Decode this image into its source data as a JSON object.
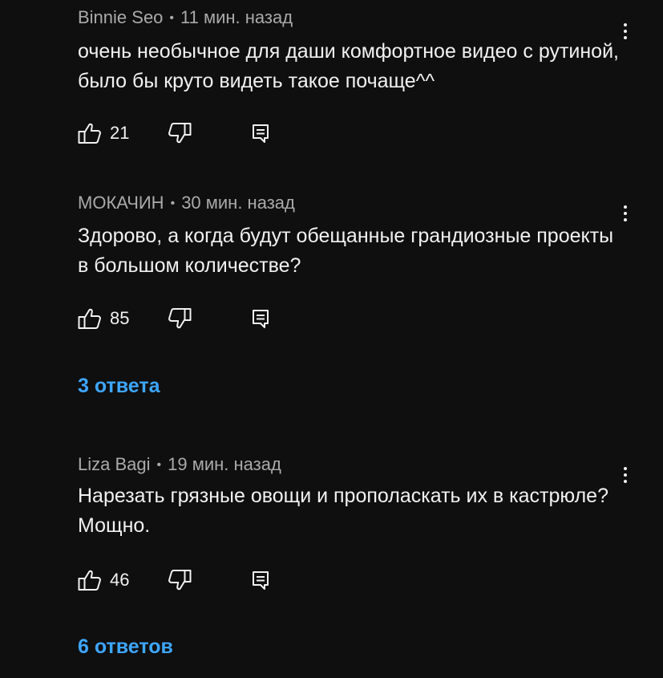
{
  "comments": [
    {
      "author": "Binnie Seo",
      "separator": "•",
      "time": "11 мин. назад",
      "text": "очень необычное для даши комфортное видео с рутиной, было бы круто видеть такое почаще^^",
      "likes": "21",
      "replies": ""
    },
    {
      "author": "МОКАЧИН",
      "separator": "•",
      "time": "30 мин. назад",
      "text": "Здорово, а когда будут обещанные грандиозные проекты в большом количестве?",
      "likes": "85",
      "replies": "3 ответа"
    },
    {
      "author": "Liza Bagi",
      "separator": "•",
      "time": "19 мин. назад",
      "text": "Нарезать грязные овощи и прополаскать их в кастрюле? Мощно.",
      "likes": "46",
      "replies": "6 ответов"
    }
  ],
  "icons": {
    "like": "thumbs-up-icon",
    "dislike": "thumbs-down-icon",
    "reply": "reply-icon",
    "menu": "more-vert-icon"
  },
  "colors": {
    "background": "#0f0f0f",
    "text": "#f1f1f1",
    "meta": "#aaaaaa",
    "link": "#3ea6ff"
  }
}
